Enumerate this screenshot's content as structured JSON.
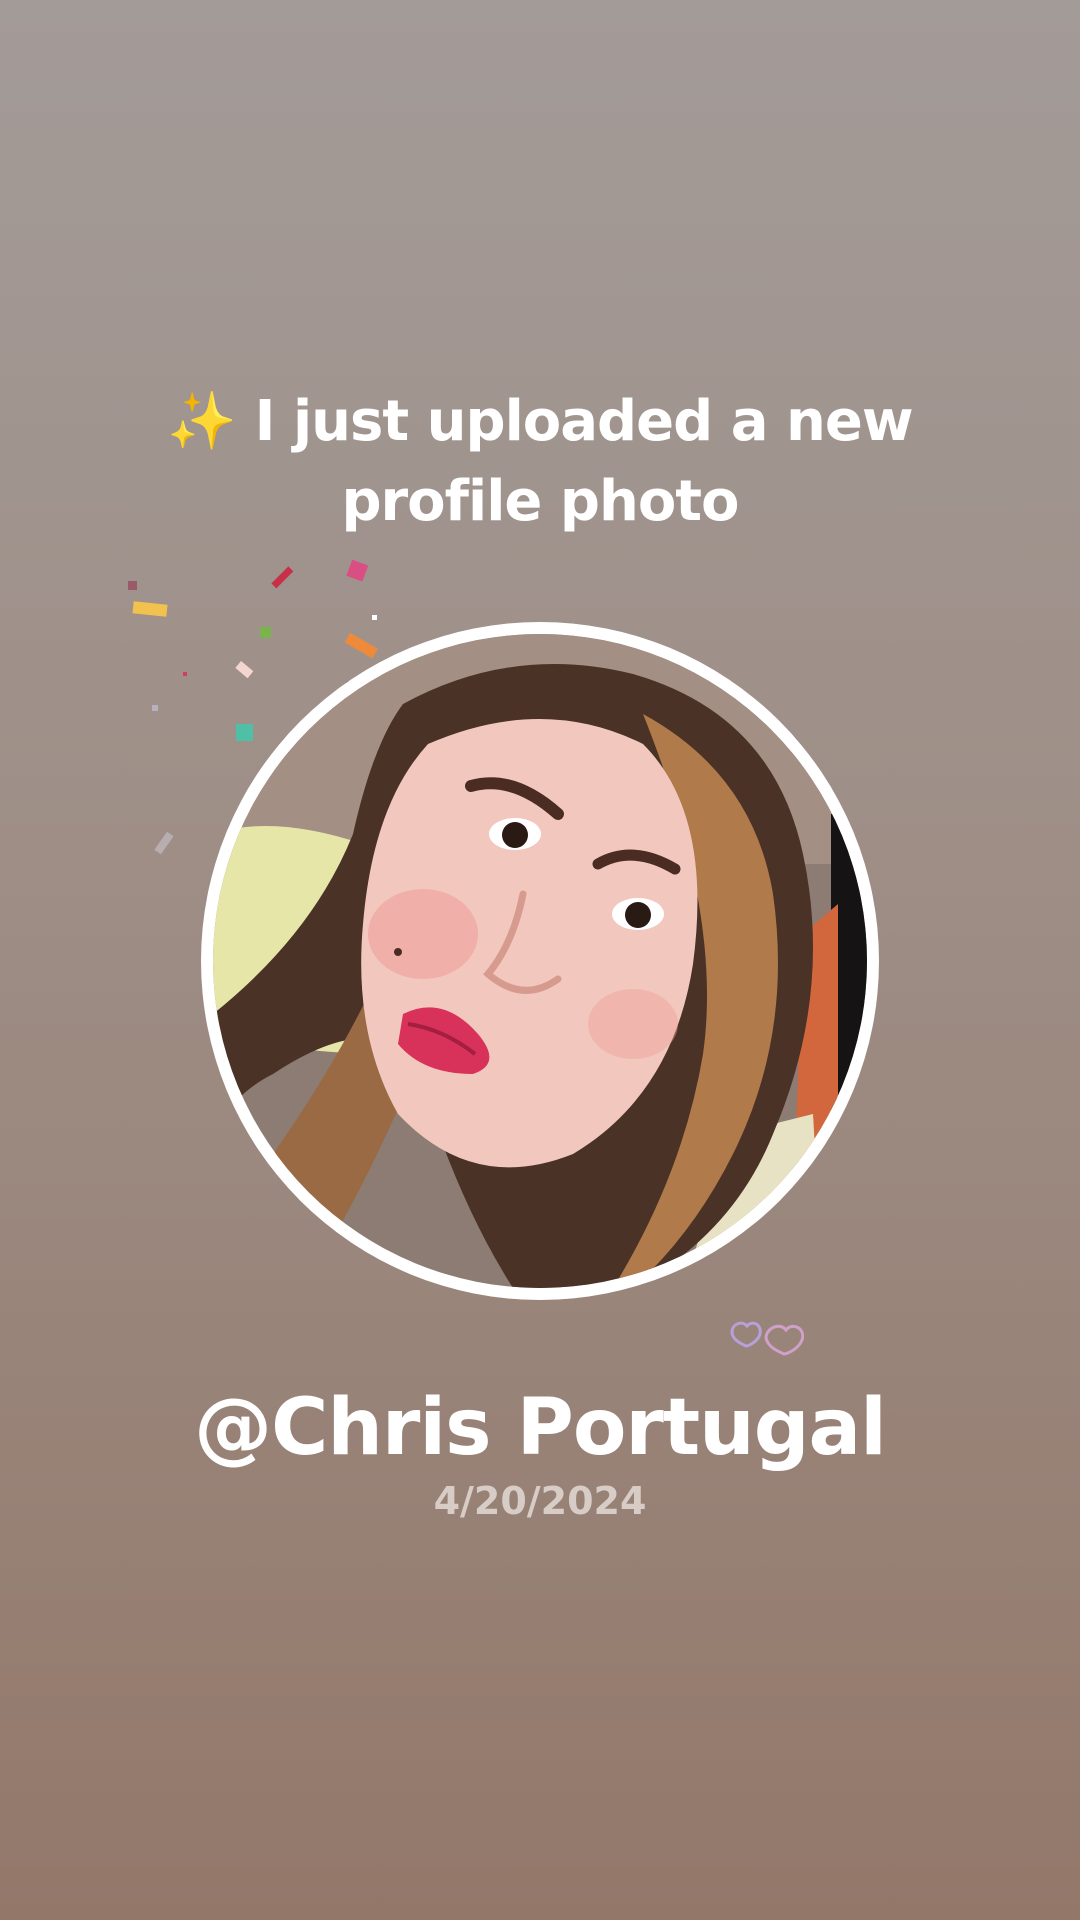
{
  "headline": {
    "sparkle": "✨",
    "line1": "I just uploaded a new",
    "line2": "profile photo"
  },
  "profile": {
    "username": "@Chris Portugal",
    "date": "4/20/2024"
  },
  "icons": {
    "sparkle": "sparkle-icon",
    "hearts": "hearts-icon",
    "confetti": "confetti-decoration"
  },
  "colors": {
    "background_top": "#a39b98",
    "background_bottom": "#93786a",
    "text": "#ffffff",
    "date_text": "#d8ccc6",
    "ring": "#ffffff"
  }
}
